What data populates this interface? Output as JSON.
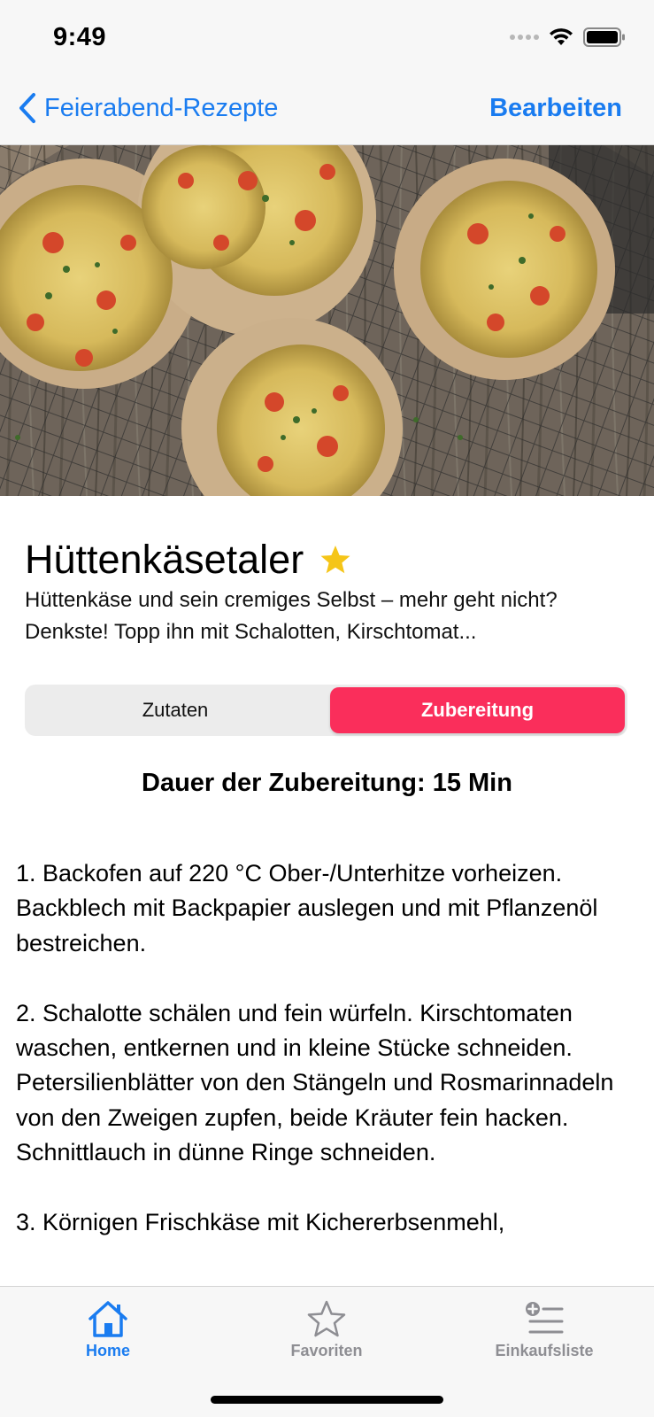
{
  "status_bar": {
    "time": "9:49"
  },
  "nav": {
    "back_label": "Feierabend-Rezepte",
    "edit_label": "Bearbeiten"
  },
  "recipe": {
    "title": "Hüttenkäsetaler",
    "favorite": true,
    "description": "Hüttenkäse und sein cremiges Selbst – mehr geht nicht? Denkste! Topp ihn mit Schalotten, Kirschtomat..."
  },
  "segments": {
    "items": [
      "Zutaten",
      "Zubereitung"
    ],
    "selected": "Zubereitung"
  },
  "duration_text": "Dauer der Zubereitung: 15 Min",
  "steps": [
    "1. Backofen auf 220 °C Ober-/Unterhitze vorheizen. Backblech mit Backpapier auslegen und mit Pflanzenöl bestreichen.",
    "2. Schalotte schälen und fein würfeln. Kirschtomaten waschen, entkernen und in kleine Stücke schneiden. Petersilienblätter von den Stängeln und Rosmarinnadeln von den Zweigen zupfen, beide Kräuter fein hacken. Schnittlauch in dünne Ringe schneiden.",
    "3. Körnigen Frischkäse mit Kichererbsenmehl,"
  ],
  "tabs": [
    {
      "label": "Home",
      "icon": "house-icon",
      "active": true
    },
    {
      "label": "Favoriten",
      "icon": "star-icon",
      "active": false
    },
    {
      "label": "Einkaufsliste",
      "icon": "list-add-icon",
      "active": false
    }
  ],
  "colors": {
    "accent_blue": "#1a7cf0",
    "segment_selected": "#fa2e5b",
    "star_yellow": "#f5c518",
    "tab_inactive": "#8e8e93"
  }
}
